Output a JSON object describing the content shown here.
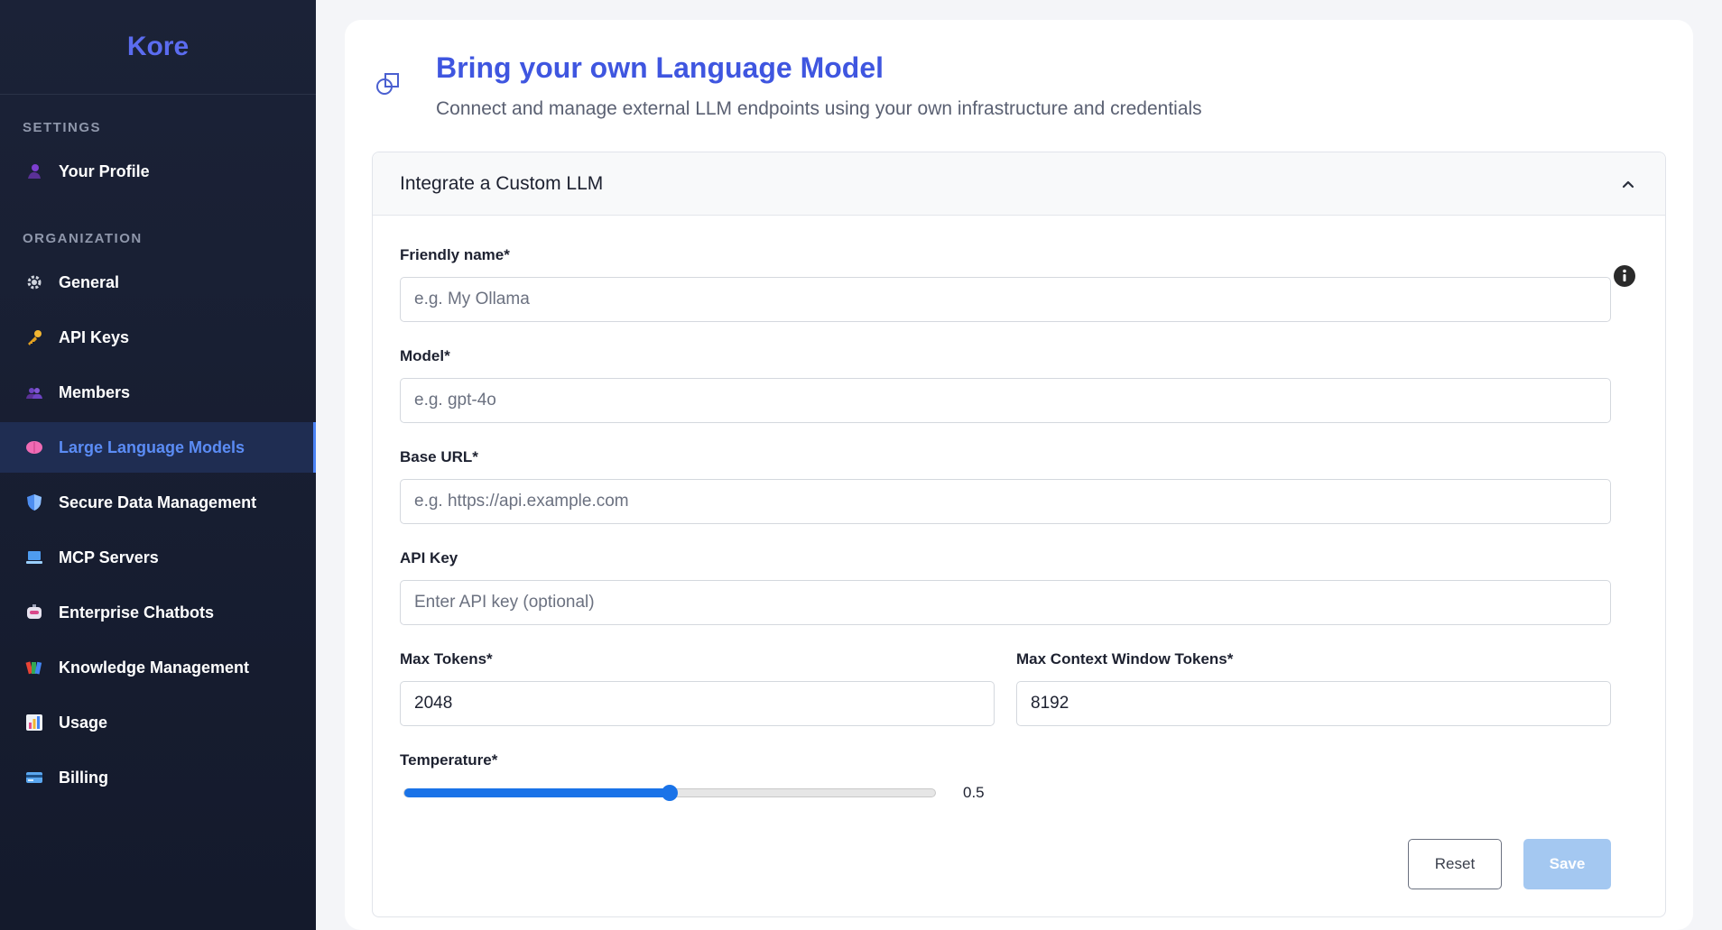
{
  "sidebar": {
    "brand": "Kore",
    "settings_label": "SETTINGS",
    "organization_label": "ORGANIZATION",
    "settings_items": [
      {
        "label": "Your Profile",
        "icon": "user-icon"
      }
    ],
    "org_items": [
      {
        "label": "General",
        "icon": "gear-icon"
      },
      {
        "label": "API Keys",
        "icon": "key-icon"
      },
      {
        "label": "Members",
        "icon": "members-icon"
      },
      {
        "label": "Large Language Models",
        "icon": "brain-icon",
        "active": true
      },
      {
        "label": "Secure Data Management",
        "icon": "shield-icon"
      },
      {
        "label": "MCP Servers",
        "icon": "laptop-icon"
      },
      {
        "label": "Enterprise Chatbots",
        "icon": "robot-icon"
      },
      {
        "label": "Knowledge Management",
        "icon": "books-icon"
      },
      {
        "label": "Usage",
        "icon": "chart-icon"
      },
      {
        "label": "Billing",
        "icon": "credit-card-icon"
      }
    ]
  },
  "header": {
    "title": "Bring your own Language Model",
    "subtitle": "Connect and manage external LLM endpoints using your own infrastructure and credentials",
    "icon": "shapes-icon"
  },
  "panel": {
    "title": "Integrate a Custom LLM",
    "fields": {
      "friendly_name": {
        "label": "Friendly name*",
        "placeholder": "e.g. My Ollama",
        "value": ""
      },
      "model": {
        "label": "Model*",
        "placeholder": "e.g. gpt-4o",
        "value": ""
      },
      "base_url": {
        "label": "Base URL*",
        "placeholder": "e.g. https://api.example.com",
        "value": ""
      },
      "api_key": {
        "label": "API Key",
        "placeholder": "Enter API key (optional)",
        "value": ""
      },
      "max_tokens": {
        "label": "Max Tokens*",
        "value": "2048"
      },
      "max_context": {
        "label": "Max Context Window Tokens*",
        "value": "8192"
      },
      "temperature": {
        "label": "Temperature*",
        "value": "0.5",
        "level": 0.5
      }
    },
    "buttons": {
      "reset": "Reset",
      "save": "Save"
    }
  },
  "colors": {
    "accent": "#3f56e0",
    "slider": "#1a73e8",
    "sidebar_bg": "#1b2237",
    "active_item": "#5b8cf5",
    "save_disabled": "#a4c8f1"
  }
}
